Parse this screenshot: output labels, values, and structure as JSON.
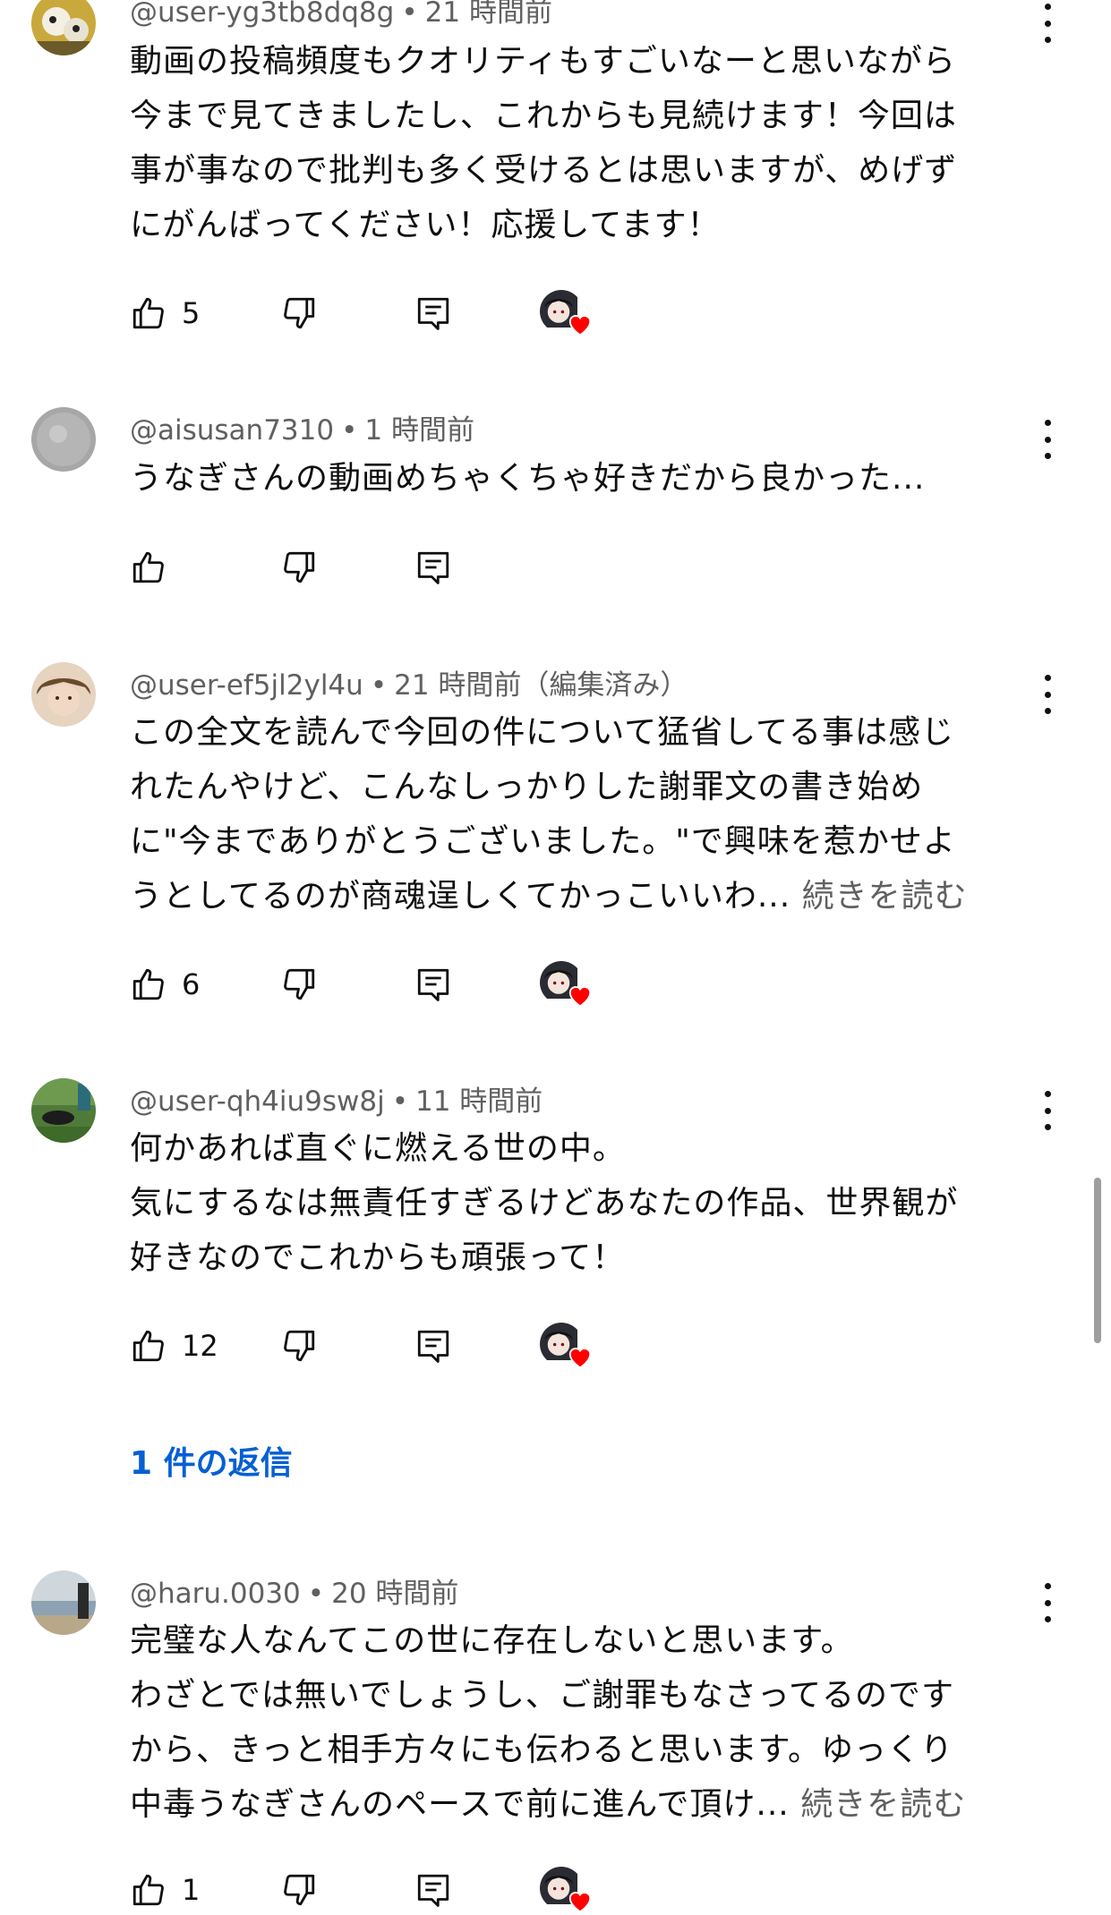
{
  "comments": [
    {
      "handle": "@user-yg3tb8dq8g",
      "time": "21 時間前",
      "lines": [
        "動画の投稿頻度もクオリティもすごいなーと思いながら",
        "今まで見てきましたし、これからも見続けます！今回は",
        "事が事なので批判も多く受けるとは思いますが、めげず",
        "にがんばってください！応援してます！"
      ],
      "likes": "5",
      "creator_heart": true
    },
    {
      "handle": "@aisusan7310",
      "time": "1 時間前",
      "lines": [
        "うなぎさんの動画めちゃくちゃ好きだから良かった..."
      ],
      "likes": "",
      "creator_heart": false
    },
    {
      "handle": "@user-ef5jl2yl4u",
      "time": "21 時間前（編集済み）",
      "lines": [
        "この全文を読んで今回の件について猛省してる事は感じ",
        "れたんやけど、こんなしっかりした謝罪文の書き始め",
        "に\"今までありがとうございました。\"で興味を惹かせよ",
        "うとしてるのが商魂逞しくてかっこいいわ..."
      ],
      "read_more": "続きを読む",
      "likes": "6",
      "creator_heart": true
    },
    {
      "handle": "@user-qh4iu9sw8j",
      "time": "11 時間前",
      "lines": [
        "何かあれば直ぐに燃える世の中。",
        "気にするなは無責任すぎるけどあなたの作品、世界観が",
        "好きなのでこれからも頑張って！"
      ],
      "likes": "12",
      "creator_heart": true,
      "replies": "1 件の返信"
    },
    {
      "handle": "@haru.0030",
      "time": "20 時間前",
      "lines": [
        "完璧な人なんてこの世に存在しないと思います。",
        "わざとでは無いでしょうし、ご謝罪もなさってるのです",
        "から、きっと相手方々にも伝わると思います。ゆっくり",
        "中毒うなぎさんのペースで前に進んで頂け..."
      ],
      "read_more": "続きを読む",
      "likes": "1",
      "creator_heart": true
    }
  ],
  "separator": "•",
  "icons": {
    "like": "thumbs-up-icon",
    "dislike": "thumbs-down-icon",
    "reply": "reply-icon",
    "menu": "more-vert-icon",
    "heart": "creator-heart-icon"
  },
  "colors": {
    "text": "#0f0f0f",
    "secondary": "#606060",
    "link": "#065fd4",
    "heart": "#ff0000"
  }
}
